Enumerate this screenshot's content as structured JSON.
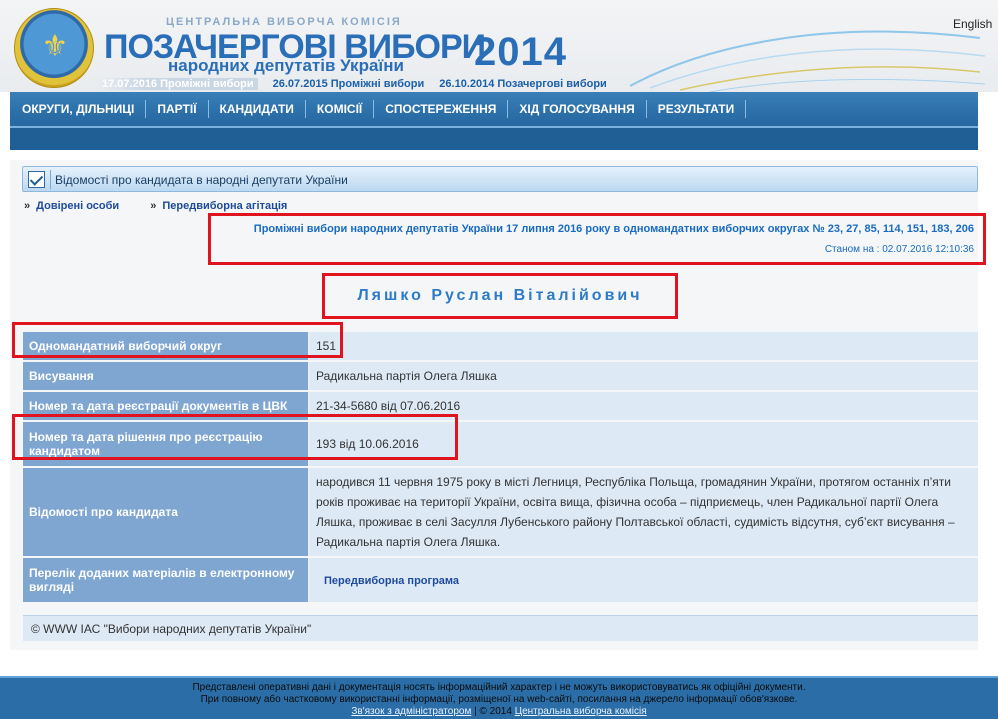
{
  "header": {
    "cvk_label": "ЦЕНТРАЛЬНА ВИБОРЧА КОМІСІЯ",
    "title": "ПОЗАЧЕРГОВІ ВИБОРИ",
    "subtitle": "народних депутатів України",
    "year": "2014",
    "english_link": "English",
    "elections": [
      "17.07.2016 Проміжні вибори",
      "26.07.2015 Проміжні вибори",
      "26.10.2014 Позачергові вибори"
    ]
  },
  "nav": {
    "items": [
      "ОКРУГИ, ДІЛЬНИЦІ",
      "ПАРТІЇ",
      "КАНДИДАТИ",
      "КОМІСІЇ",
      "СПОСТЕРЕЖЕННЯ",
      "ХІД ГОЛОСУВАННЯ",
      "РЕЗУЛЬТАТИ"
    ]
  },
  "section": {
    "title": "Відомості про кандидата в народні депутати України"
  },
  "sublinks": [
    "Довірені особи",
    "Передвиборна агітація"
  ],
  "election_info": {
    "headline": "Проміжні вибори народних депутатів України 17 липня 2016 року в одномандатних виборчих округах № 23, 27, 85, 114, 151, 183, 206",
    "status": "Станом на : 02.07.2016 12:10:36"
  },
  "candidate": {
    "name": "Ляшко Руслан Віталійович",
    "rows": [
      {
        "label": "Одномандатний виборчий округ",
        "value": "151"
      },
      {
        "label": "Висування",
        "value": "Радикальна партія Олега Ляшка"
      },
      {
        "label": "Номер та дата реєстрації документів в ЦВК",
        "value": "21-34-5680 від 07.06.2016"
      },
      {
        "label": "Номер та дата рішення про реєстрацію кандидатом",
        "value": "193 від 10.06.2016"
      },
      {
        "label": "Відомості про кандидата",
        "value": "народився 11 червня 1975 року в місті Легниця, Республіка Польща, громадянин України, протягом останніх п’яти років проживає на території України, освіта вища, фізична особа – підприємець, член Радикальної партії Олега Ляшка, проживає в селі Засулля Лубенського району Полтавської області, судимість відсутня, суб’єкт висування – Радикальна партія Олега Ляшка."
      },
      {
        "label": "Перелік доданих матеріалів в електронному вигляді",
        "value": "Передвиборна програма"
      }
    ]
  },
  "copyright": "© WWW ІАС \"Вибори народних депутатів України\"",
  "footer": {
    "line1": "Представлені оперативні дані і документація носять інформаційний характер і не можуть використовуватись як офіційні документи.",
    "line2": "При повному або частковому використанні інформації, розміщеної на web-сайті, посилання на джерело інформації обов'язкове.",
    "admin_link": "Зв'язок з адміністратором",
    "copy_mid": "| © 2014",
    "cvk_link": "Центральна виборча комісія"
  },
  "colors": {
    "brand_blue": "#2a6eb8",
    "highlight_red": "#e0141f"
  }
}
